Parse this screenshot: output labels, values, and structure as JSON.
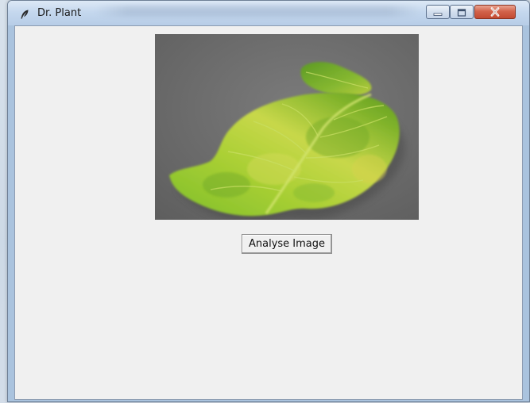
{
  "window": {
    "title": "Dr. Plant",
    "app_icon": "feather-icon",
    "controls": {
      "minimize_icon": "minimize-icon",
      "maximize_icon": "maximize-icon",
      "close_icon": "close-icon"
    }
  },
  "main": {
    "image": {
      "subject": "leaf",
      "colors": {
        "background": "#6b6b6b",
        "leaf_primary": "#8fc92e",
        "leaf_secondary": "#c9d84a",
        "vein": "#cfe36a"
      }
    },
    "analyse_button": {
      "label": "Analyse Image"
    }
  }
}
